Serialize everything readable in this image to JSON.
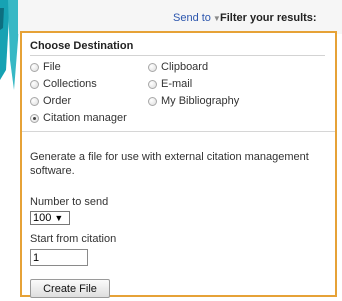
{
  "header": {
    "send_to_label": "Send to",
    "send_to_caret": "▼",
    "filter_label": "Filter your results:"
  },
  "destination": {
    "title": "Choose Destination",
    "options": [
      {
        "label": "File",
        "checked": false
      },
      {
        "label": "Clipboard",
        "checked": false
      },
      {
        "label": "Collections",
        "checked": false
      },
      {
        "label": "E-mail",
        "checked": false
      },
      {
        "label": "Order",
        "checked": false
      },
      {
        "label": "My Bibliography",
        "checked": false
      },
      {
        "label": "Citation manager",
        "checked": true
      }
    ]
  },
  "citation": {
    "description": "Generate a file for use with external citation management software.",
    "number_label": "Number to send",
    "number_value": "100",
    "number_arrow": "▼",
    "start_label": "Start from citation",
    "start_value": "1",
    "button_label": "Create File"
  },
  "colors": {
    "accent_border": "#e6a237",
    "link": "#2c56ad",
    "sidebar_teal": "#1aa6b7"
  },
  "icons": {
    "send_to_caret": "caret-down-icon",
    "radio": "radio-button-icon",
    "select_arrow": "dropdown-arrow-icon"
  }
}
